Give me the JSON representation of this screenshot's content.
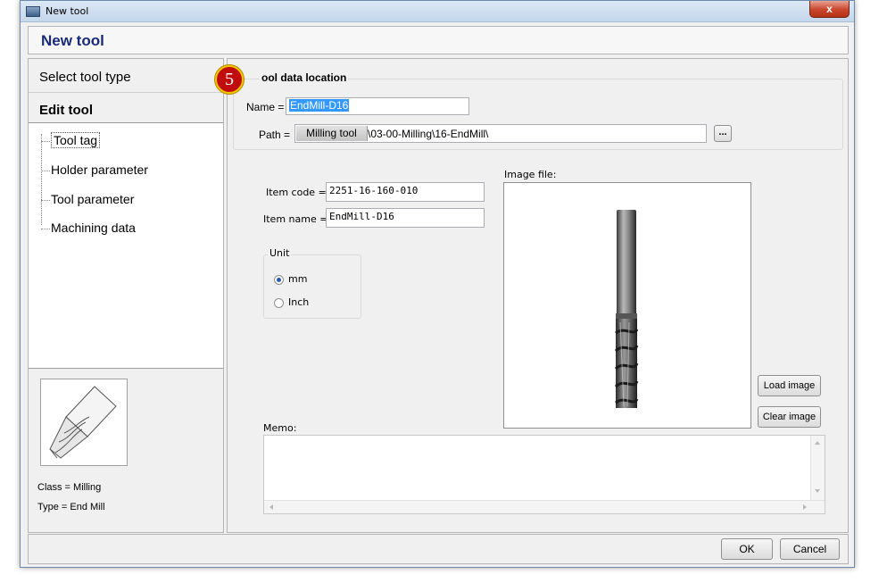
{
  "window": {
    "title": "New tool",
    "close_glyph": "x"
  },
  "header": {
    "title": "New tool"
  },
  "sidebar": {
    "steps": [
      {
        "label": "Select tool type"
      },
      {
        "label": "Edit tool"
      }
    ],
    "tree": [
      {
        "label": "Tool tag"
      },
      {
        "label": "Holder parameter"
      },
      {
        "label": "Tool parameter"
      },
      {
        "label": "Machining data"
      }
    ],
    "class_text": "Class = Milling",
    "type_text": "Type = End Mill"
  },
  "badge": {
    "number": "5"
  },
  "location": {
    "group_title": "ool data location",
    "name_label": "Name =",
    "name_value": "EndMill-D16",
    "path_label": "Path =",
    "path_prefix_button": "Milling tool",
    "path_value": "\\03-00-Milling\\16-EndMill\\",
    "browse_label": "..."
  },
  "item": {
    "code_label": "Item code =",
    "code_value": "2251-16-160-010",
    "name_label": "Item name =",
    "name_value": "EndMill-D16"
  },
  "unit": {
    "group_title": "Unit",
    "options": [
      {
        "label": "mm",
        "selected": true
      },
      {
        "label": "Inch",
        "selected": false
      }
    ]
  },
  "image": {
    "label": "Image file:",
    "load_button": "Load image",
    "clear_button": "Clear image"
  },
  "memo": {
    "label": "Memo:",
    "value": ""
  },
  "footer": {
    "ok_button": "OK",
    "cancel_button": "Cancel"
  },
  "icons": {
    "app": "window-app-icon",
    "close": "close-icon",
    "thumbnail": "end-mill-thumbnail-icon",
    "preview": "end-mill-preview-image"
  },
  "colors": {
    "header_title": "#1a2b7a",
    "badge_fill": "#c00c0c",
    "badge_ring": "#f5c400",
    "selected_text_bg": "#3399ff"
  }
}
